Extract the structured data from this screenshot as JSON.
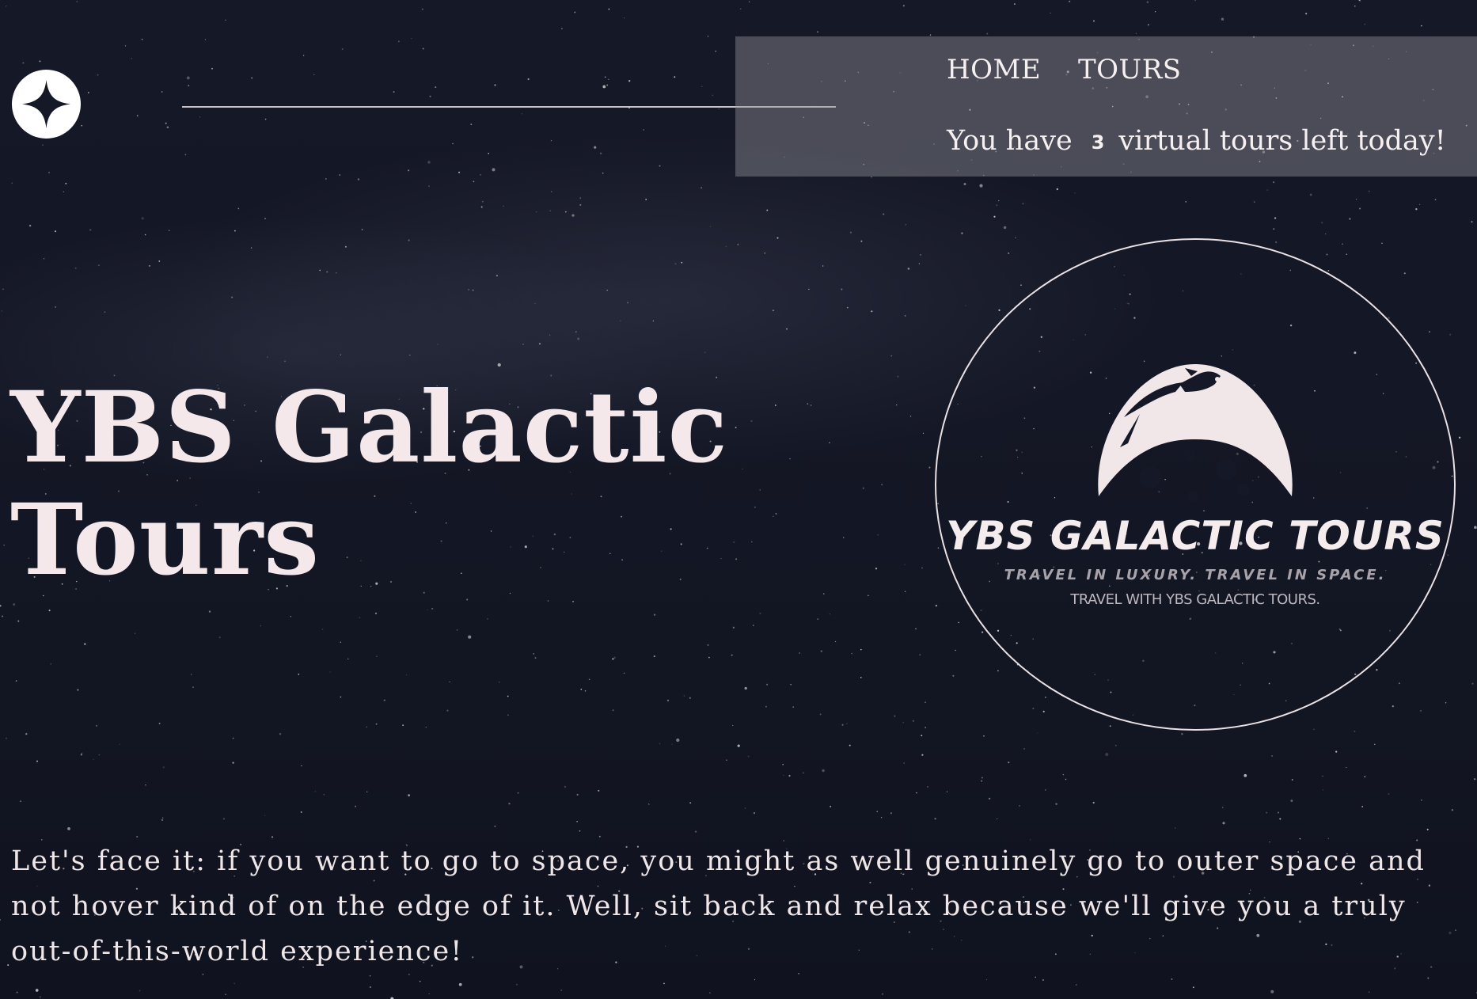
{
  "nav": {
    "links": [
      {
        "label": "HOME"
      },
      {
        "label": "TOURS"
      }
    ],
    "tours_left": {
      "prefix": "You have",
      "count": "3",
      "suffix": "virtual tours left today!"
    }
  },
  "hero": {
    "title_line1": "YBS Galactic",
    "title_line2": "Tours"
  },
  "brand_logo": {
    "name": "YBS GALACTIC TOURS",
    "tagline1": "TRAVEL IN LUXURY. TRAVEL IN SPACE.",
    "tagline2": "TRAVEL WITH YBS GALACTIC TOURS.",
    "icon": "moon-rocket-icon"
  },
  "site_logo": {
    "icon": "four-point-star-icon"
  },
  "intro": {
    "text": "Let's face it: if you want to go to space, you might as well genuinely go to outer space and not hover kind of on the edge of it. Well, sit back and relax because we'll give you a truly out-of-this-world experience!"
  },
  "colors": {
    "background": "#141725",
    "text": "#f4e8ea",
    "nav_panel": "rgba(150,150,158,0.42)"
  }
}
